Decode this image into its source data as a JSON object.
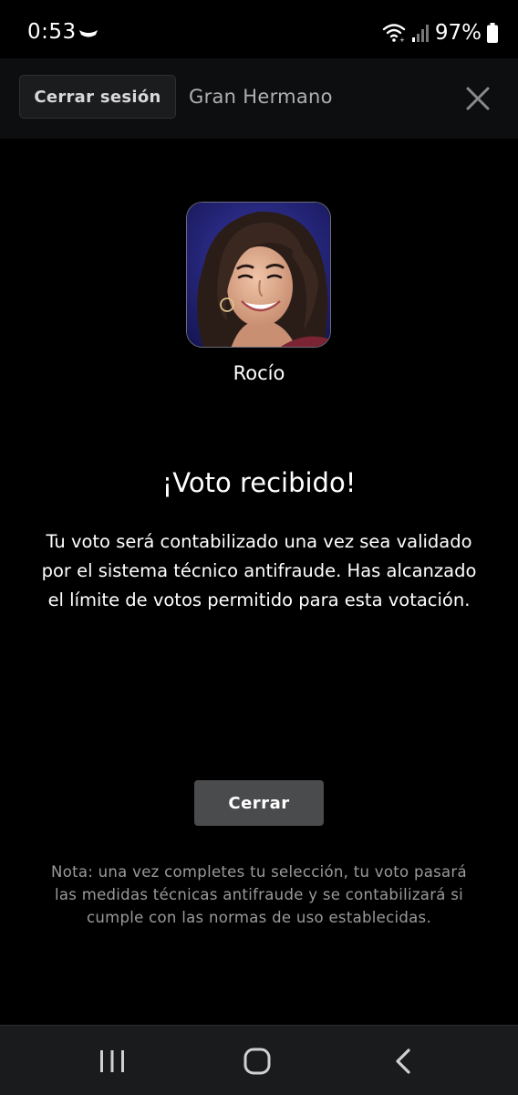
{
  "status_bar": {
    "time": "0:53",
    "battery": "97%",
    "icons": [
      "app-notification-icon",
      "wifi-icon",
      "signal-icon",
      "battery-icon"
    ]
  },
  "header": {
    "logout_label": "Cerrar sesión",
    "title": "Gran Hermano",
    "close_icon": "close-icon"
  },
  "contestant": {
    "name": "Rocío"
  },
  "confirmation": {
    "title": "¡Voto recibido!",
    "message": "Tu voto será contabilizado una vez sea validado por el sistema técnico antifraude. Has alcanzado el límite de votos permitido para esta votación.",
    "close_label": "Cerrar",
    "note": "Nota: una vez completes tu selección, tu voto pasará las medidas técnicas antifraude y se contabilizará si cumple con las normas de uso establecidas."
  },
  "nav_bar": {
    "icons": [
      "recents-icon",
      "home-icon",
      "back-icon"
    ]
  },
  "colors": {
    "background": "#000000",
    "header_bg": "#0c0e10",
    "button_bg": "#4a4b4d",
    "note_text": "#9a9a9a",
    "nav_bg": "#1a1b1d"
  }
}
